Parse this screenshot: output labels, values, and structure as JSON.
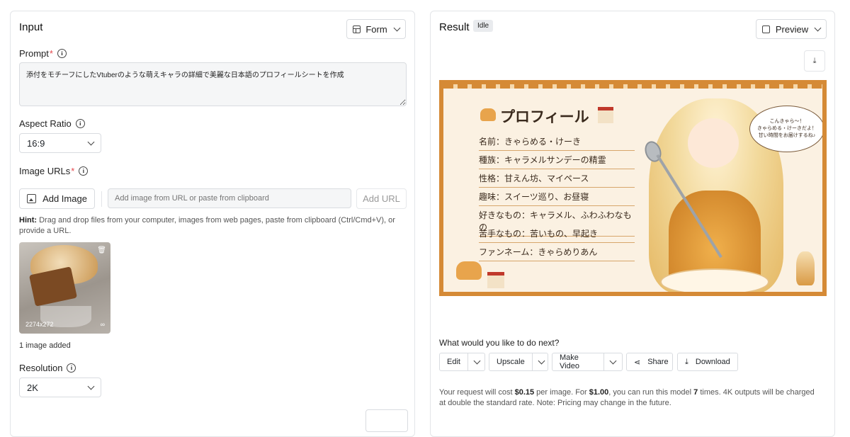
{
  "left": {
    "title": "Input",
    "mode_label": "Form",
    "prompt_label": "Prompt",
    "prompt_value": "添付をモチーフにしたVtuberのような萌えキャラの詳細で美麗な日本語のプロフィールシートを作成",
    "aspect_label": "Aspect Ratio",
    "aspect_value": "16:9",
    "image_urls_label": "Image URLs",
    "add_image_label": "Add Image",
    "url_placeholder": "Add image from URL or paste from clipboard",
    "add_url_label": "Add URL",
    "hint_bold": "Hint:",
    "hint_text": " Drag and drop files from your computer, images from web pages, paste from clipboard (Ctrl/Cmd+V), or provide a URL.",
    "thumb_size": "2274x272",
    "images_added": "1 image added",
    "resolution_label": "Resolution",
    "resolution_value": "2K"
  },
  "right": {
    "title": "Result",
    "status_badge": "Idle",
    "preview_label": "Preview",
    "image": {
      "heading": "プロフィール",
      "lines": [
        "名前：きゃらめる・けーき",
        "種族：キャラメルサンデーの精霊",
        "性格：甘えん坊、マイペース",
        "趣味：スイーツ巡り、お昼寝",
        "好きなもの：キャラメル、ふわふわなもの",
        "苦手なもの：苦いもの、早起き",
        "ファンネーム：きゃらめりあん"
      ],
      "bubble": [
        "こんきゃら〜！",
        "きゃらめる・けーきだよ！",
        "甘い時間をお届けするね♪"
      ]
    },
    "next_label": "What would you like to do next?",
    "actions": {
      "edit": "Edit",
      "upscale": "Upscale",
      "make_video": "Make Video",
      "share": "Share",
      "download": "Download"
    },
    "cost": {
      "p1": "Your request will cost ",
      "price": "$0.15",
      "p2": " per image. For ",
      "dollar": "$1.00",
      "p3": ", you can run this model ",
      "runs": "7",
      "p4": " times. 4K outputs will be charged at double the standard rate. Note: Pricing may change in the future."
    }
  },
  "colors": {
    "accent": "#d58a36",
    "required": "#e5484d"
  }
}
